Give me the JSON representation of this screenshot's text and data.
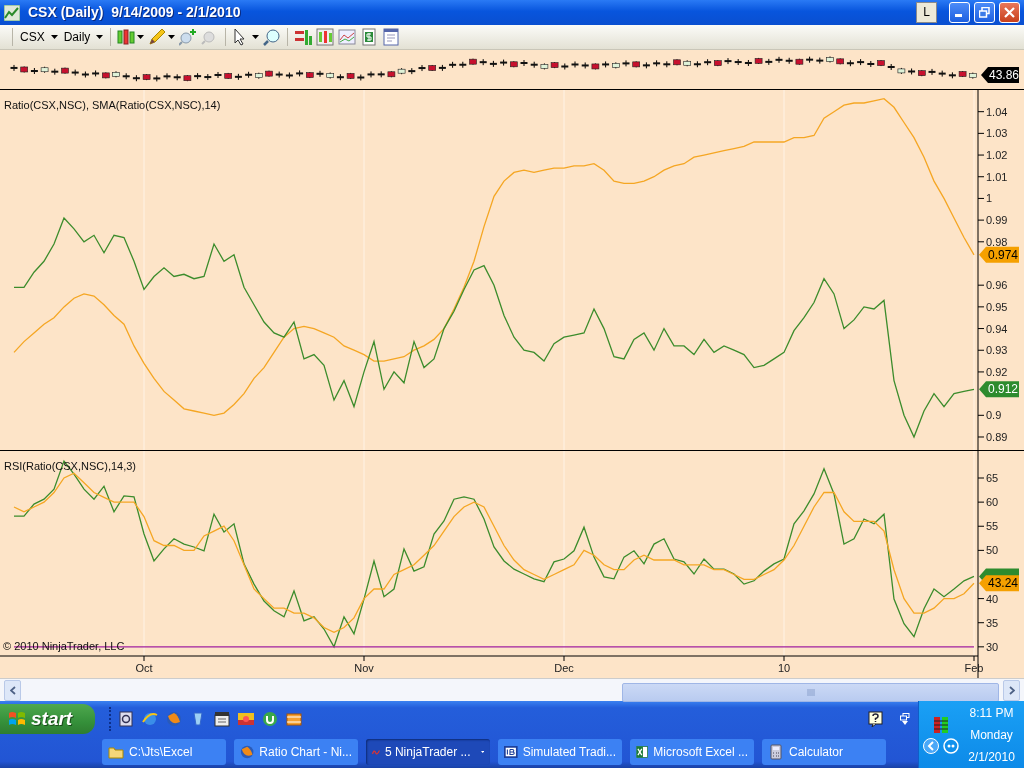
{
  "window": {
    "title": "CSX (Daily)  9/14/2009 - 2/1/2010",
    "title_button": "L"
  },
  "toolbar": {
    "instrument": "CSX",
    "interval": "Daily"
  },
  "price_panel": {
    "price_label": "43.86"
  },
  "ratio_panel": {
    "title": "Ratio(CSX,NSC), SMA(Ratio(CSX,NSC),14)",
    "markers": [
      {
        "text": "0.974",
        "color": "#f5a000"
      },
      {
        "text": "0.912",
        "color": "#2e8b2e"
      }
    ],
    "chart_data": {
      "type": "line",
      "grid": true,
      "ylim": [
        0.884,
        1.05
      ],
      "yticks": [
        0.89,
        0.9,
        0.92,
        0.93,
        0.94,
        0.95,
        0.96,
        0.98,
        0.99,
        1,
        1.01,
        1.02,
        1.03,
        1.04
      ],
      "series": [
        {
          "color": "#f5a623",
          "values": [
            0.929,
            0.934,
            0.938,
            0.942,
            0.945,
            0.95,
            0.954,
            0.956,
            0.955,
            0.951,
            0.946,
            0.942,
            0.932,
            0.924,
            0.917,
            0.911,
            0.907,
            0.903,
            0.902,
            0.901,
            0.9,
            0.901,
            0.905,
            0.91,
            0.917,
            0.922,
            0.929,
            0.936,
            0.94,
            0.941,
            0.94,
            0.938,
            0.936,
            0.932,
            0.93,
            0.928,
            0.925,
            0.925,
            0.926,
            0.927,
            0.93,
            0.932,
            0.935,
            0.94,
            0.949,
            0.959,
            0.971,
            0.987,
            1.001,
            1.008,
            1.012,
            1.013,
            1.012,
            1.013,
            1.014,
            1.014,
            1.015,
            1.015,
            1.016,
            1.013,
            1.008,
            1.007,
            1.007,
            1.008,
            1.01,
            1.013,
            1.015,
            1.016,
            1.019,
            1.02,
            1.021,
            1.022,
            1.023,
            1.024,
            1.026,
            1.026,
            1.026,
            1.026,
            1.028,
            1.028,
            1.029,
            1.037,
            1.04,
            1.043,
            1.044,
            1.044,
            1.045,
            1.046,
            1.042,
            1.035,
            1.028,
            1.019,
            1.008,
            1.0,
            0.991,
            0.982,
            0.974
          ]
        },
        {
          "color": "#3c8c2c",
          "values": [
            0.959,
            0.959,
            0.966,
            0.971,
            0.979,
            0.991,
            0.986,
            0.98,
            0.983,
            0.975,
            0.983,
            0.982,
            0.971,
            0.958,
            0.964,
            0.968,
            0.964,
            0.965,
            0.963,
            0.964,
            0.979,
            0.971,
            0.974,
            0.959,
            0.951,
            0.943,
            0.938,
            0.936,
            0.943,
            0.926,
            0.928,
            0.923,
            0.907,
            0.916,
            0.904,
            0.92,
            0.934,
            0.912,
            0.92,
            0.915,
            0.934,
            0.922,
            0.926,
            0.94,
            0.948,
            0.958,
            0.967,
            0.969,
            0.96,
            0.946,
            0.936,
            0.93,
            0.929,
            0.925,
            0.933,
            0.936,
            0.937,
            0.938,
            0.949,
            0.94,
            0.927,
            0.926,
            0.935,
            0.938,
            0.93,
            0.94,
            0.932,
            0.932,
            0.928,
            0.935,
            0.929,
            0.932,
            0.93,
            0.928,
            0.922,
            0.923,
            0.926,
            0.929,
            0.939,
            0.945,
            0.952,
            0.963,
            0.956,
            0.94,
            0.944,
            0.95,
            0.949,
            0.953,
            0.916,
            0.9,
            0.89,
            0.902,
            0.91,
            0.904,
            0.91,
            0.911,
            0.912
          ]
        }
      ]
    }
  },
  "rsi_panel": {
    "title": "RSI(Ratio(CSX,NSC),14,3)",
    "copyright": "© 2010 NinjaTrader, LLC",
    "markers": [
      {
        "color": "#2e8b2e"
      },
      {
        "text": "43.24",
        "color": "#f5a000"
      }
    ],
    "chart_data": {
      "type": "line",
      "grid": true,
      "ylim": [
        28.1,
        70.6
      ],
      "yticks": [
        30,
        35,
        40,
        50,
        55,
        60,
        65
      ],
      "categories": [
        null,
        null,
        null,
        null,
        null,
        null,
        null,
        null,
        null,
        null,
        null,
        null,
        null,
        "Oct",
        null,
        null,
        null,
        null,
        null,
        null,
        null,
        null,
        null,
        null,
        null,
        null,
        null,
        null,
        null,
        null,
        null,
        null,
        null,
        null,
        null,
        "Nov",
        null,
        null,
        null,
        null,
        null,
        null,
        null,
        null,
        null,
        null,
        null,
        null,
        null,
        null,
        null,
        null,
        null,
        null,
        null,
        "Dec",
        null,
        null,
        null,
        null,
        null,
        null,
        null,
        null,
        null,
        null,
        null,
        null,
        null,
        null,
        null,
        null,
        null,
        null,
        null,
        null,
        null,
        "10",
        null,
        null,
        null,
        null,
        null,
        null,
        null,
        null,
        null,
        null,
        null,
        null,
        null,
        null,
        null,
        null,
        null,
        null,
        "Feb"
      ],
      "series": [
        {
          "color": "#3c8c2c",
          "values": [
            57.1,
            57.1,
            59.6,
            60.6,
            62.7,
            68.5,
            65.8,
            62.7,
            60.6,
            63.3,
            58.0,
            61.3,
            61.1,
            53.4,
            47.8,
            50.3,
            52.4,
            51.3,
            50.7,
            49.9,
            57.5,
            53.8,
            55.5,
            47.2,
            43.0,
            39.5,
            37.5,
            36.2,
            41.6,
            35.4,
            36.2,
            33.7,
            30.0,
            36.2,
            32.7,
            39.9,
            47.8,
            40.4,
            42.0,
            50.3,
            45.7,
            46.6,
            53.4,
            56.1,
            60.6,
            61.1,
            60.6,
            56.5,
            50.7,
            47.8,
            46.1,
            45.1,
            44.1,
            43.5,
            47.6,
            48.2,
            49.9,
            54.8,
            48.6,
            44.5,
            44.1,
            48.6,
            49.9,
            47.2,
            51.3,
            52.4,
            48.2,
            47.6,
            45.1,
            48.2,
            46.1,
            46.1,
            45.1,
            43.0,
            43.7,
            45.7,
            47.2,
            48.2,
            55.5,
            58.2,
            61.7,
            66.9,
            61.7,
            51.3,
            52.4,
            56.5,
            55.5,
            57.5,
            39.9,
            34.8,
            32.1,
            37.9,
            42.0,
            40.4,
            42.0,
            43.7,
            44.6
          ]
        },
        {
          "color": "#f5a623",
          "values": [
            59,
            58,
            59,
            60,
            62,
            65,
            66,
            64,
            62,
            61,
            60,
            60,
            60,
            57,
            52,
            51,
            51,
            50,
            50,
            53,
            54,
            55,
            52,
            47,
            42,
            40,
            38,
            38,
            37,
            37,
            36,
            34,
            33,
            34,
            36,
            40,
            42,
            42,
            45,
            46,
            47,
            49,
            51,
            54,
            57,
            59,
            60,
            59,
            55,
            51,
            48,
            46,
            45,
            44,
            45,
            46,
            47,
            50,
            49,
            47,
            46,
            46,
            48,
            49,
            48,
            48,
            48,
            47,
            47,
            47,
            46,
            46,
            45,
            44,
            44,
            45,
            46,
            48,
            51,
            55,
            59,
            62,
            62,
            58,
            56,
            56,
            56,
            54,
            46,
            40,
            37,
            37,
            38,
            40,
            40,
            41,
            43.2
          ]
        },
        {
          "color": "#a020a0",
          "values": [
            30,
            30,
            30,
            30,
            30,
            30,
            30,
            30,
            30,
            30,
            30,
            30,
            30,
            30,
            30,
            30,
            30,
            30,
            30,
            30,
            30,
            30,
            30,
            30,
            30,
            30,
            30,
            30,
            30,
            30,
            30,
            30,
            30,
            30,
            30,
            30,
            30,
            30,
            30,
            30,
            30,
            30,
            30,
            30,
            30,
            30,
            30,
            30,
            30,
            30,
            30,
            30,
            30,
            30,
            30,
            30,
            30,
            30,
            30,
            30,
            30,
            30,
            30,
            30,
            30,
            30,
            30,
            30,
            30,
            30,
            30,
            30,
            30,
            30,
            30,
            30,
            30,
            30,
            30,
            30,
            30,
            30,
            30,
            30,
            30,
            30,
            30,
            30,
            30,
            30,
            30,
            30,
            30,
            30,
            30,
            30,
            30
          ]
        }
      ]
    }
  },
  "taskbar": {
    "start": "start",
    "tasks": [
      {
        "label": "C:\\Jts\\Excel",
        "selected": false
      },
      {
        "label": "Ratio Chart - Ni...",
        "selected": false
      },
      {
        "label": "5 NinjaTrader ...",
        "selected": true
      },
      {
        "label": "Simulated Tradi...",
        "selected": false
      },
      {
        "label": "Microsoft Excel ...",
        "selected": false
      },
      {
        "label": "Calculator",
        "selected": false
      }
    ],
    "clock": {
      "time": "8:11 PM",
      "day": "Monday",
      "date": "2/1/2010"
    }
  }
}
